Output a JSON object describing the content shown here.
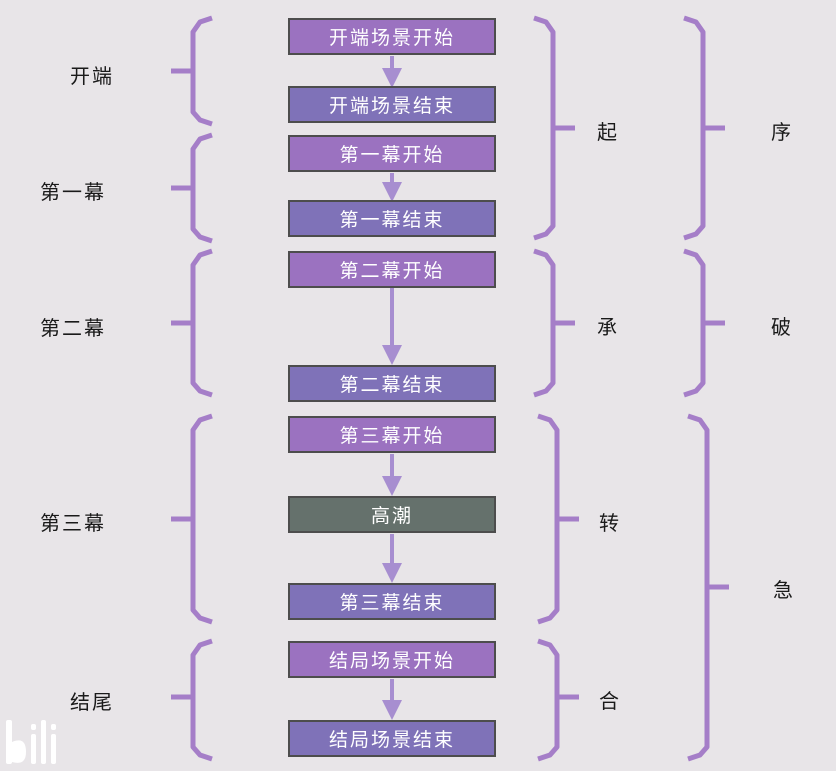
{
  "colors": {
    "background": "#e8e5e8",
    "start_box": "#9b72c0",
    "end_box": "#7f72b8",
    "climax_box": "#65716c",
    "bracket": "#a57ec8",
    "arrow": "#a78ed0",
    "border": "#4d4d4d"
  },
  "boxes": {
    "opening_start": "开端场景开始",
    "opening_end": "开端场景结束",
    "act1_start": "第一幕开始",
    "act1_end": "第一幕结束",
    "act2_start": "第二幕开始",
    "act2_end": "第二幕结束",
    "act3_start": "第三幕开始",
    "climax": "高潮",
    "act3_end": "第三幕结束",
    "ending_start": "结局场景开始",
    "ending_end": "结局场景结束"
  },
  "left_labels": {
    "opening": "开端",
    "act1": "第一幕",
    "act2": "第二幕",
    "act3": "第三幕",
    "ending": "结尾"
  },
  "middle_labels": {
    "qi": "起",
    "cheng": "承",
    "zhuan": "转",
    "he": "合"
  },
  "right_labels": {
    "xu": "序",
    "po": "破",
    "ji": "急"
  },
  "logo": "bili"
}
